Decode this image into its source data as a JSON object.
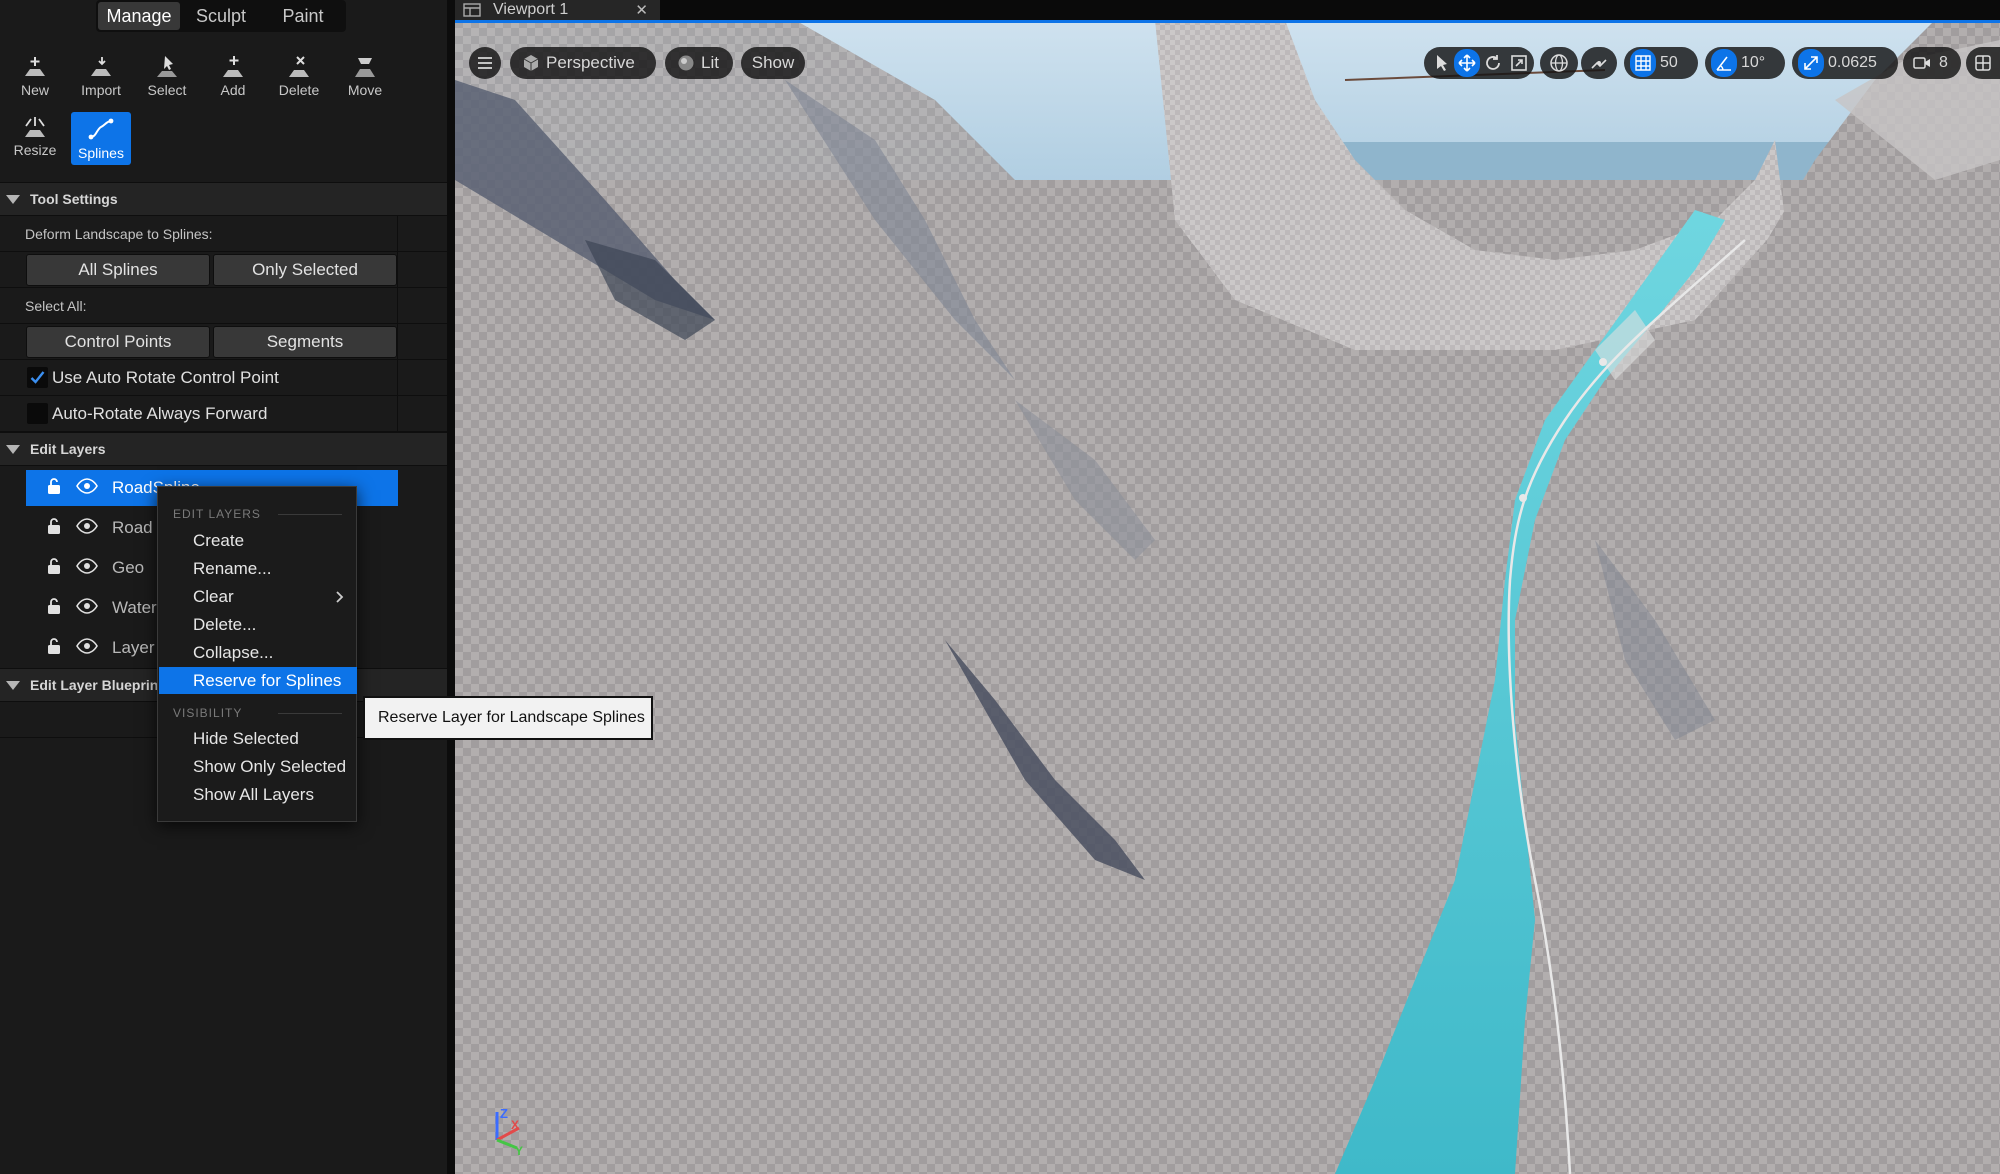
{
  "mode_tabs": {
    "manage": "Manage",
    "sculpt": "Sculpt",
    "paint": "Paint"
  },
  "tools": {
    "new": "New",
    "import": "Import",
    "select": "Select",
    "add": "Add",
    "delete": "Delete",
    "move": "Move",
    "resize": "Resize",
    "splines": "Splines"
  },
  "tool_settings": {
    "header": "Tool Settings",
    "deform_label": "Deform Landscape to Splines:",
    "all_splines": "All Splines",
    "only_selected": "Only Selected",
    "select_all_label": "Select All:",
    "control_points": "Control Points",
    "segments": "Segments",
    "auto_rotate": "Use Auto Rotate Control Point",
    "auto_rotate_checked": true,
    "always_forward": "Auto-Rotate Always Forward",
    "always_forward_checked": false
  },
  "edit_layers": {
    "header": "Edit Layers",
    "layers": [
      {
        "name": "RoadSpline",
        "selected": true
      },
      {
        "name": "Road",
        "selected": false
      },
      {
        "name": "Geo",
        "selected": false
      },
      {
        "name": "Water",
        "selected": false
      },
      {
        "name": "Layer",
        "selected": false
      }
    ]
  },
  "edit_layer_blueprint": {
    "header": "Edit Layer Blueprint"
  },
  "viewport": {
    "tab_label": "Viewport 1",
    "perspective": "Perspective",
    "lit": "Lit",
    "show": "Show",
    "grid_snap": "50",
    "rotation_snap": "10°",
    "scale_snap": "0.0625",
    "camera_speed": "8",
    "axis_z": "Z",
    "axis_x": "X",
    "axis_y": "Y"
  },
  "context_menu": {
    "heading_edit_layers": "EDIT LAYERS",
    "create": "Create",
    "rename": "Rename...",
    "clear": "Clear",
    "delete": "Delete...",
    "collapse": "Collapse...",
    "reserve": "Reserve for Splines",
    "heading_visibility": "VISIBILITY",
    "hide_selected": "Hide Selected",
    "show_only_selected": "Show Only Selected",
    "show_all_layers": "Show All Layers"
  },
  "tooltip": {
    "text": "Reserve Layer for Landscape Splines"
  },
  "colors": {
    "accent": "#0d74e8",
    "water": "#4fc3d2",
    "panel": "#1a1a1a"
  }
}
